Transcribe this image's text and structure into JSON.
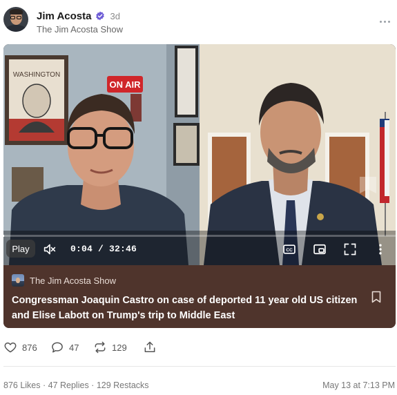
{
  "author": {
    "name": "Jim Acosta",
    "verified_icon": "verified-badge-icon",
    "time_ago": "3d",
    "publication": "The Jim Acosta Show",
    "accent_color": "#6e5dd6"
  },
  "video": {
    "play_label": "Play",
    "time_current": "0:04",
    "time_separator": " / ",
    "time_total": "32:46",
    "progress": 0.002,
    "scene_signs": {
      "portrait_label": "WASHINGTON",
      "on_air_label": "ON AIR"
    },
    "controls": [
      "mute-icon",
      "closed-captions-icon",
      "miniplayer-icon",
      "fullscreen-icon",
      "more-vertical-icon"
    ]
  },
  "card": {
    "publication": "The Jim Acosta Show",
    "title": "Congressman Joaquin Castro on case of deported 11 year old US citizen and Elise Labott on Trump's trip to Middle East",
    "background_color": "#4f342c"
  },
  "actions": {
    "likes": "876",
    "comments": "47",
    "restacks": "129"
  },
  "footer": {
    "likes_text": "876 Likes",
    "separator": " · ",
    "replies_text": "47 Replies",
    "restacks_text": "129 Restacks",
    "date": "May 13 at 7:13 PM"
  }
}
